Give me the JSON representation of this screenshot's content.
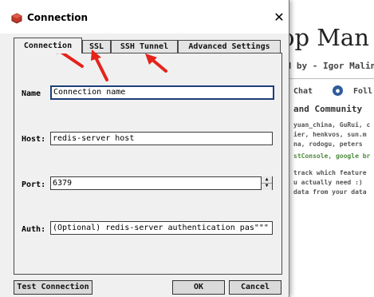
{
  "background": {
    "title": "op Man",
    "author": "ed by - Igor Malin",
    "chat": "Chat",
    "follow": "Foll",
    "section": "and Community",
    "lines": [
      "yuan_china, GuRui, c",
      "ier, henkvos, sun.m",
      "na, rodogu, peters",
      "stConsole, google br",
      "track which feature",
      "u actually need :)",
      "data from your data"
    ]
  },
  "dialog": {
    "title": "Connection",
    "close_glyph": "✕",
    "tabs": [
      "Connection",
      "SSL",
      "SSH Tunnel",
      "Advanced Settings"
    ],
    "fields": {
      "name": {
        "label": "Name",
        "value": "Connection name"
      },
      "host": {
        "label": "Host:",
        "value": "redis-server host"
      },
      "port": {
        "label": "Port:",
        "value": "6379"
      },
      "auth": {
        "label": "Auth:",
        "value": "(Optional) redis-server authentication pas\"\"\""
      }
    },
    "buttons": {
      "test": "Test Connection",
      "ok": "OK",
      "cancel": "Cancel"
    }
  },
  "colors": {
    "annotation_arrow": "#e5231b",
    "focus_border": "#1b3f7a",
    "app_icon": "#c0392b"
  }
}
